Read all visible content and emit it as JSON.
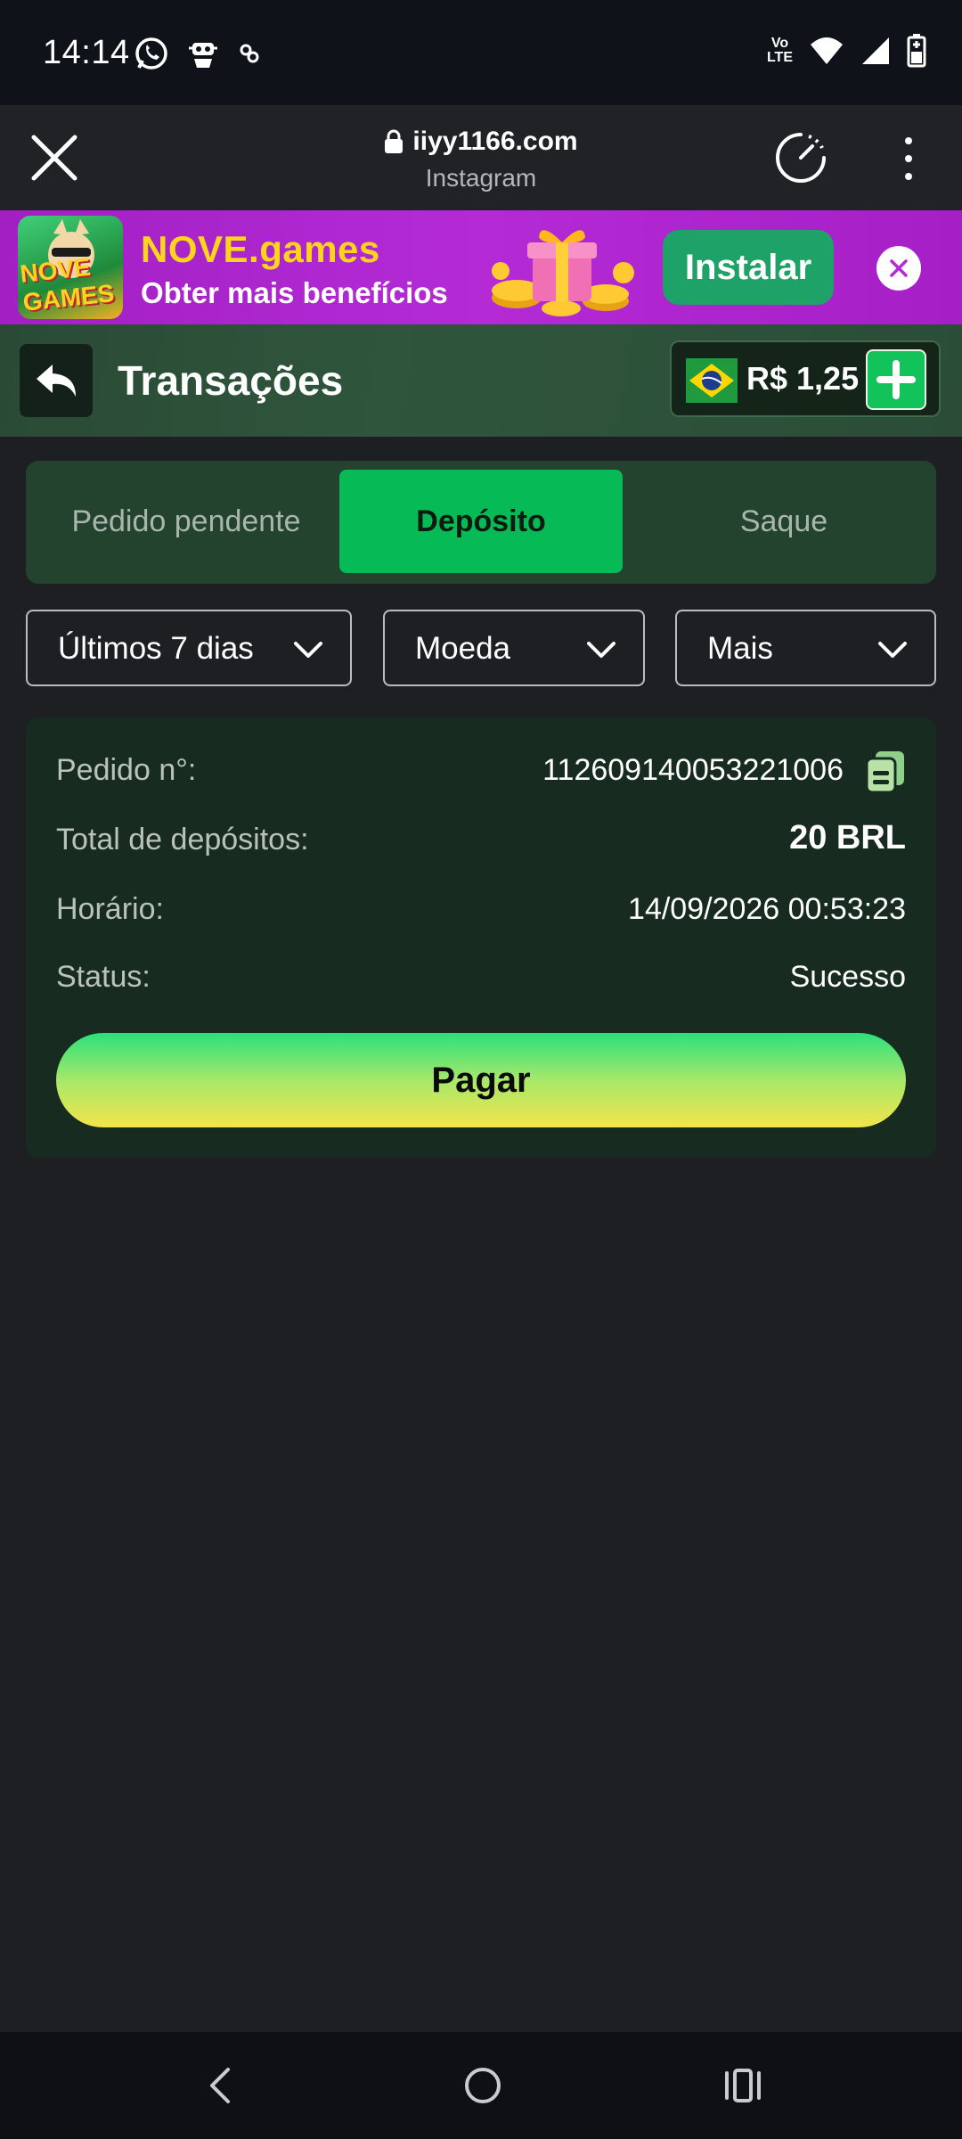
{
  "status_bar": {
    "time": "14:14",
    "network": "Vo LTE"
  },
  "browser": {
    "domain": "iiyy1166.com",
    "source": "Instagram"
  },
  "banner": {
    "logo_text": "NOVE GAMES",
    "title": "NOVE.games",
    "subtitle": "Obter mais benefícios",
    "install_label": "Instalar"
  },
  "header": {
    "title": "Transações",
    "balance": "R$ 1,25"
  },
  "tabs": [
    {
      "label": "Pedido pendente",
      "active": false
    },
    {
      "label": "Depósito",
      "active": true
    },
    {
      "label": "Saque",
      "active": false
    }
  ],
  "filters": [
    {
      "label": "Últimos 7 dias"
    },
    {
      "label": "Moeda"
    },
    {
      "label": "Mais"
    }
  ],
  "transaction": {
    "order_label": "Pedido n°:",
    "order_value": "112609140053221006",
    "total_label": "Total de depósitos:",
    "total_value": "20 BRL",
    "time_label": "Horário:",
    "time_value": "14/09/2026 00:53:23",
    "status_label": "Status:",
    "status_value": "Sucesso",
    "pay_label": "Pagar"
  },
  "colors": {
    "accent": "#06bb55",
    "background": "#1d1f23",
    "banner": "#b42bd6"
  }
}
